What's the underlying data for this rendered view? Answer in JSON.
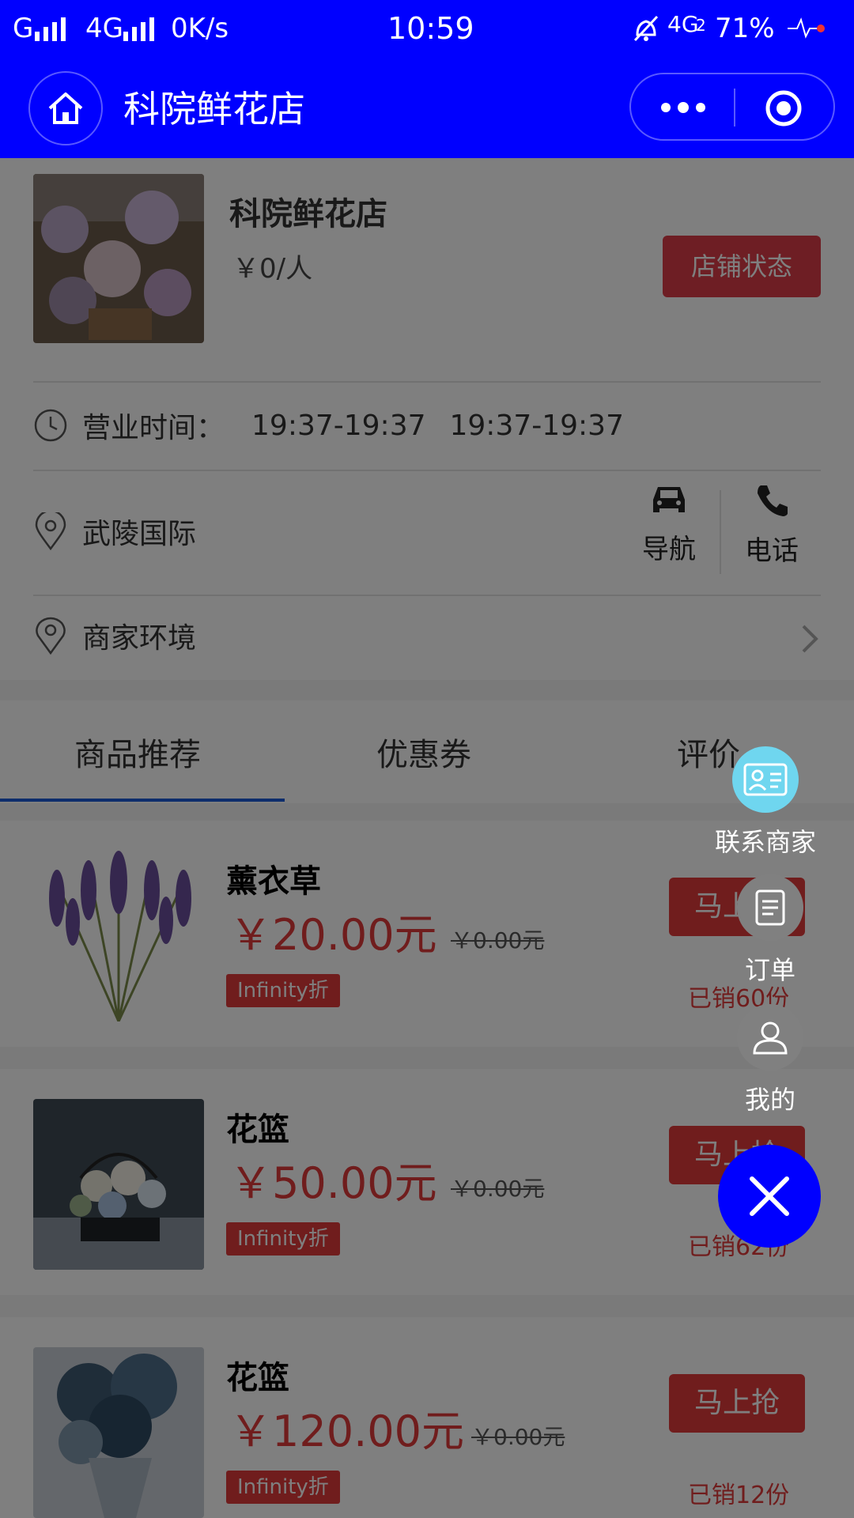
{
  "status_bar": {
    "network_left": "G",
    "network_mid": "4G",
    "speed": "0K/s",
    "time": "10:59",
    "network_right": "4G",
    "network_right_sub": "2",
    "battery": "71%"
  },
  "nav": {
    "title": "科院鲜花店",
    "home_icon": "home-icon",
    "more_icon": "more-dots-icon",
    "close_icon": "target-circle-icon"
  },
  "shop": {
    "name": "科院鲜花店",
    "price": "￥0/人",
    "status_button": "店铺状态",
    "hours_label": "营业时间：",
    "hours_1": "19:37-19:37",
    "hours_2": "19:37-19:37",
    "address": "武陵国际",
    "navigate_label": "导航",
    "phone_label": "电话",
    "environment_label": "商家环境"
  },
  "tabs": [
    {
      "label": "商品推荐",
      "active": true
    },
    {
      "label": "优惠券",
      "active": false
    },
    {
      "label": "评价",
      "active": false
    }
  ],
  "products": [
    {
      "name": "薰衣草",
      "price": "￥20.00元",
      "original_price": "￥0.00元",
      "discount": "Infinity折",
      "buy_label": "马上抢",
      "sold": "已销60份"
    },
    {
      "name": "花篮",
      "price": "￥50.00元",
      "original_price": "￥0.00元",
      "discount": "Infinity折",
      "buy_label": "马上抢",
      "sold": "已销62份"
    },
    {
      "name": "花篮",
      "price": "￥120.00元",
      "original_price": "￥0.00元",
      "discount": "Infinity折",
      "buy_label": "马上抢",
      "sold": "已销12份"
    }
  ],
  "fab_menu": {
    "contact_label": "联系商家",
    "order_label": "订单",
    "mine_label": "我的"
  },
  "colors": {
    "brand_blue": "#0000ff",
    "accent_red": "#e03b3b",
    "contact_circle": "#6fd6ef"
  }
}
